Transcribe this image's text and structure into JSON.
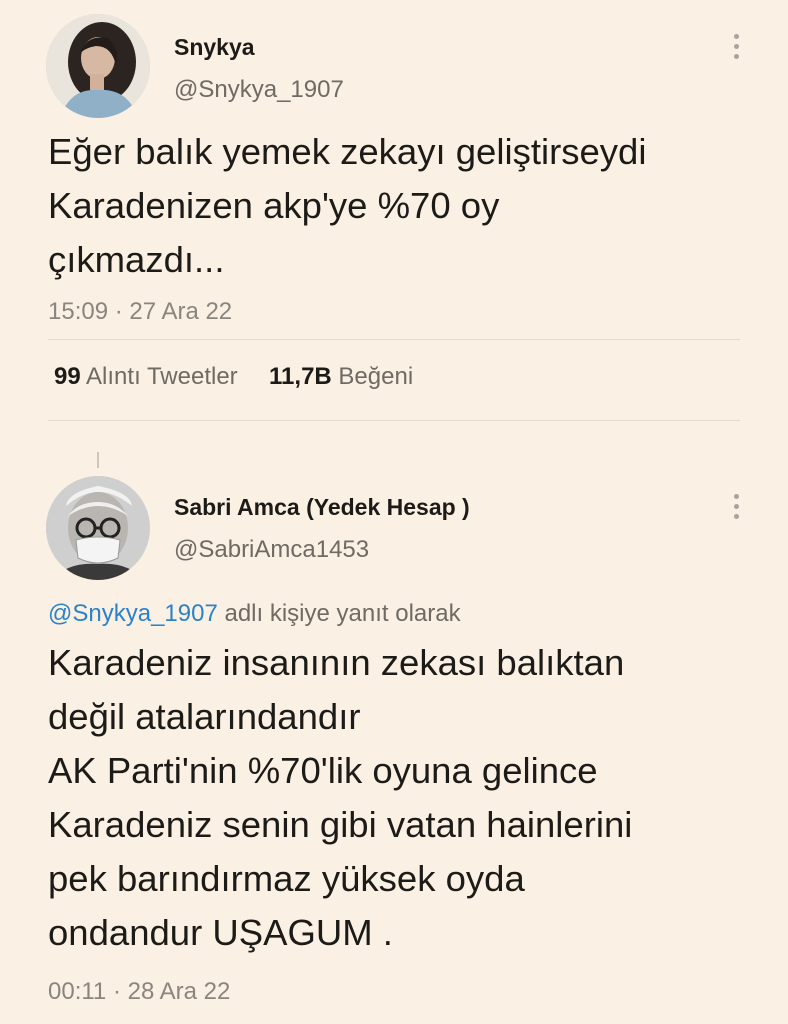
{
  "tweet1": {
    "display_name": "Snykya",
    "handle": "@Snykya_1907",
    "text_lines": [
      "Eğer balık yemek zekayı geliştirseydi",
      "Karadenizen akp'ye %70 oy",
      "çıkmazdı..."
    ],
    "time": "15:09",
    "separator": "·",
    "date": "27 Ara 22",
    "stats": {
      "quote_count": "99",
      "quote_label": "Alıntı Tweetler",
      "like_count": "11,7B",
      "like_label": "Beğeni"
    }
  },
  "tweet2": {
    "display_name": "Sabri Amca (Yedek Hesap )",
    "handle": "@SabriAmca1453",
    "reply_to_handle": "@Snykya_1907",
    "reply_to_suffix": "adlı kişiye yanıt olarak",
    "text_lines": [
      "Karadeniz insanının zekası balıktan",
      "değil atalarındandır",
      "AK Parti'nin %70'lik oyuna gelince",
      "Karadeniz senin gibi vatan hainlerini",
      "pek barındırmaz yüksek oyda",
      "ondandur UŞAGUM ."
    ],
    "time": "00:11",
    "separator": "·",
    "date": "28 Ara 22"
  },
  "icons": {
    "more": "more-vertical-icon"
  },
  "colors": {
    "background": "#faf0e4",
    "mention": "#2b82c8",
    "secondary_text": "#6e6a64"
  }
}
